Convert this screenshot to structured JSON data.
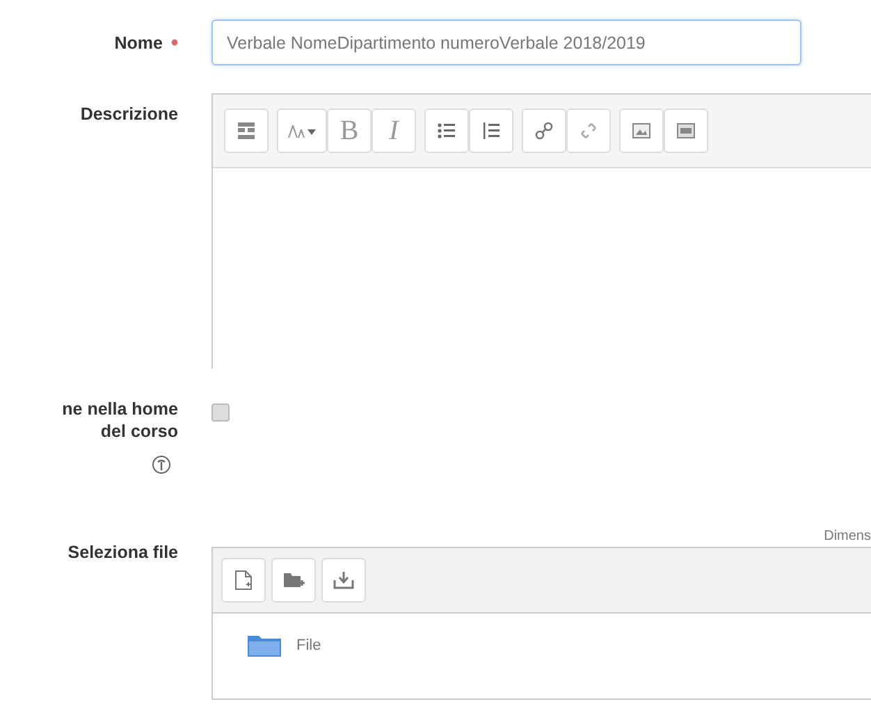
{
  "fields": [
    {
      "kind": "text",
      "label": "Nome",
      "required": true,
      "value": "Verbale NomeDipartimento numeroVerbale 2018/2019"
    },
    {
      "kind": "editor",
      "label": "Descrizione",
      "toolbar": [
        [
          {
            "kind": "collapse"
          }
        ],
        [
          {
            "kind": "font-size"
          },
          {
            "kind": "bold",
            "label": "B"
          },
          {
            "kind": "italic",
            "label": "I"
          }
        ],
        [
          {
            "kind": "bullets"
          },
          {
            "kind": "numbering"
          }
        ],
        [
          {
            "kind": "link"
          },
          {
            "kind": "unlink"
          }
        ],
        [
          {
            "kind": "image"
          },
          {
            "kind": "media"
          }
        ]
      ]
    },
    {
      "kind": "checkbox",
      "label_lines": [
        "ne nella home",
        "del corso"
      ],
      "checked": false,
      "help": true
    },
    {
      "kind": "filemanager",
      "label": "Seleziona file",
      "note": "Dimens",
      "toolbar": [
        {
          "kind": "add-file"
        },
        {
          "kind": "add-folder"
        },
        {
          "kind": "download"
        }
      ],
      "files": [
        {
          "kind": "folder",
          "name": "File"
        }
      ]
    }
  ]
}
